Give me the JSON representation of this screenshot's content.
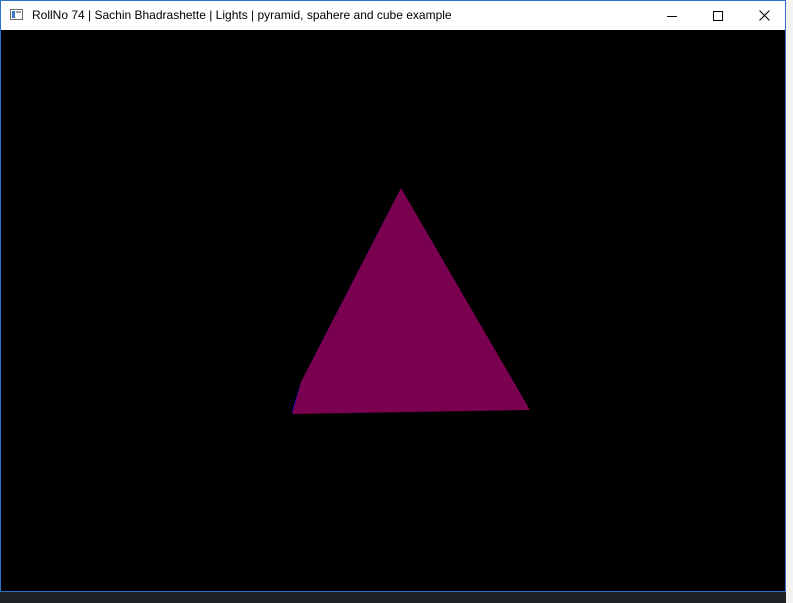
{
  "window": {
    "title": "RollNo 74 | Sachin Bhadrashette | Lights | pyramid, spahere and cube example",
    "frame_color": "#2f6ec9",
    "controls": {
      "minimize_icon": "minimize-icon",
      "maximize_icon": "maximize-icon",
      "close_icon": "close-icon"
    }
  },
  "scene": {
    "background": "#000000",
    "pyramid_front_face_color": "#7a0050",
    "pyramid_side_face_color": "#0000dd"
  }
}
